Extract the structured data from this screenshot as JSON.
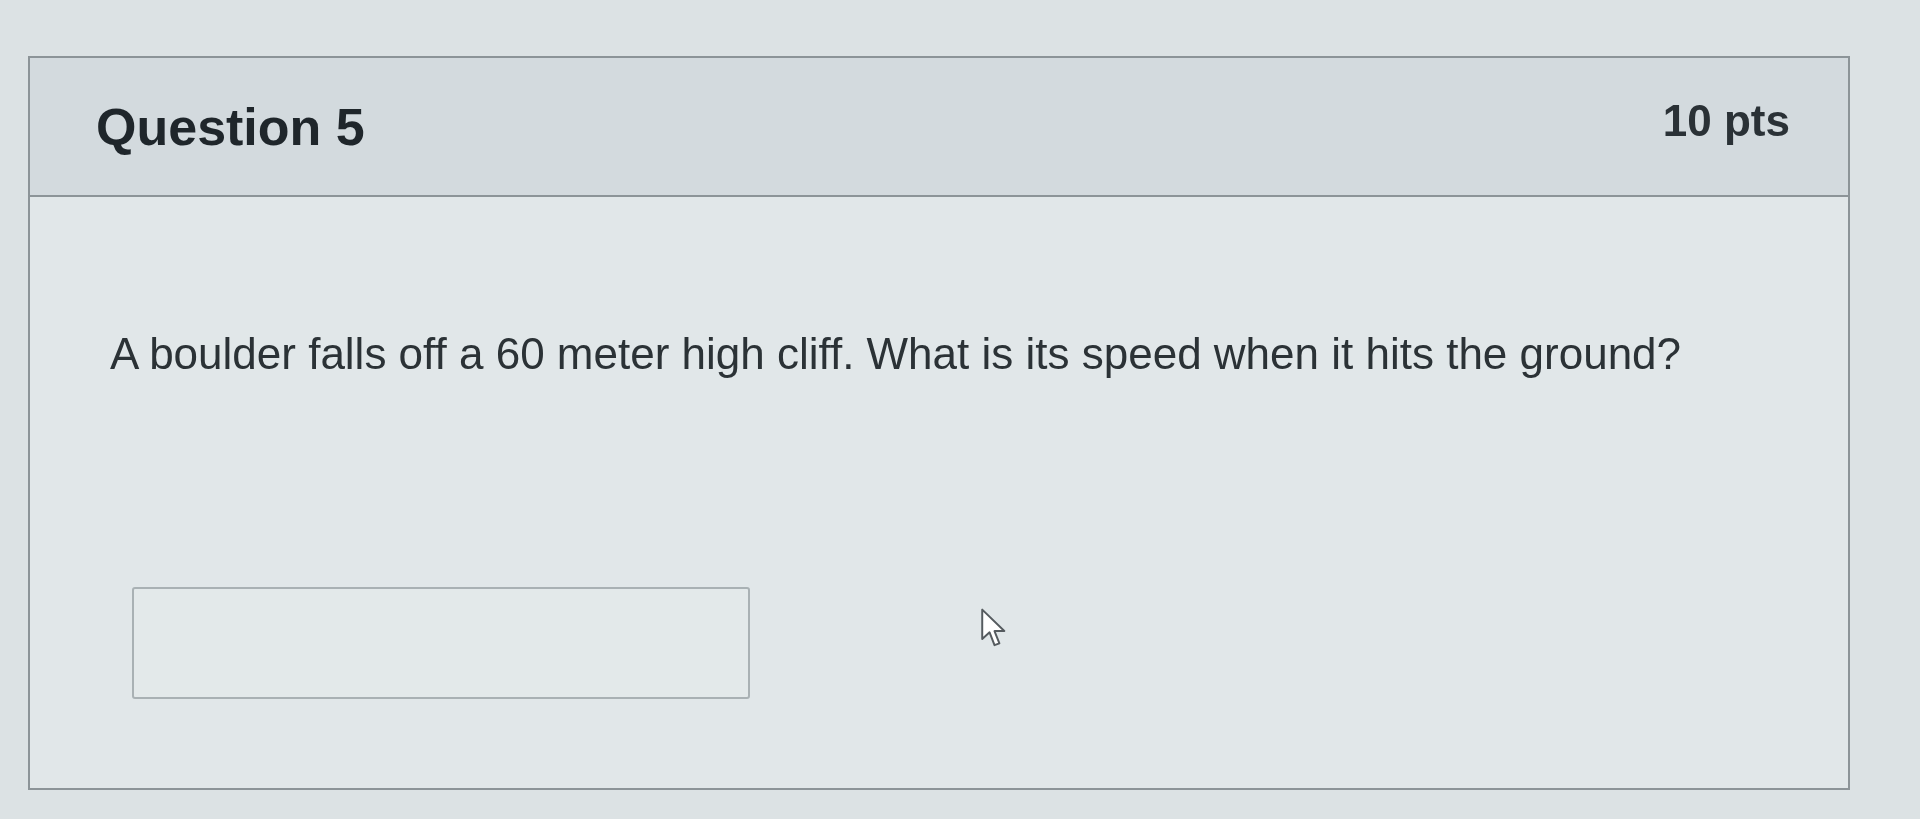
{
  "question": {
    "title": "Question 5",
    "points": "10 pts",
    "text": "A boulder falls off a 60 meter high cliff. What is its speed when it hits the ground?"
  }
}
